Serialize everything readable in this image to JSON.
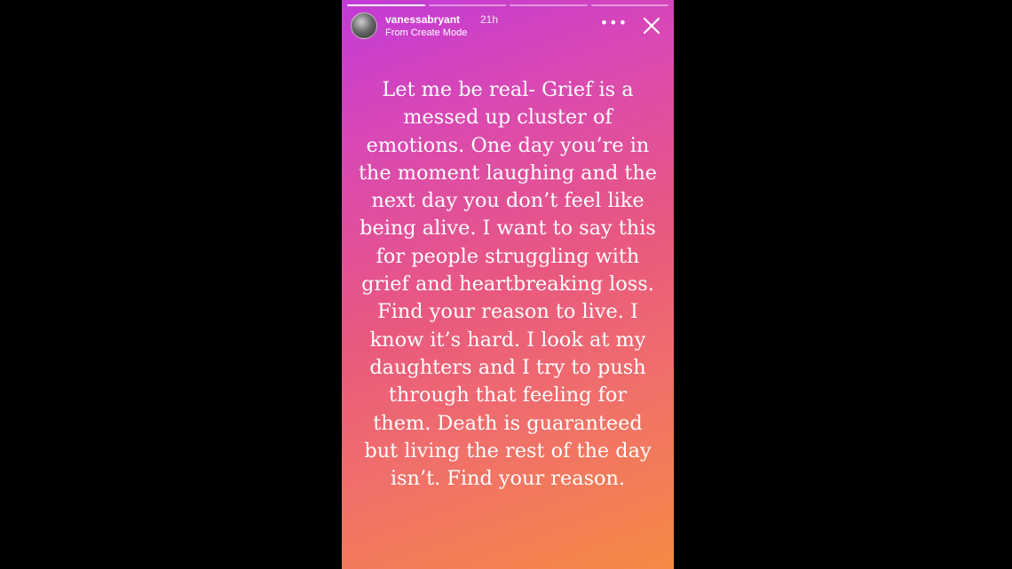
{
  "story": {
    "username": "vanessabryant",
    "time_ago": "21h",
    "subtitle": "From Create Mode",
    "more_icon": "more-horizontal-icon",
    "close_icon": "close-icon",
    "progress_segments": 4,
    "text": "Let me be real- Grief is a messed up cluster of emotions. One day you’re in the moment laughing and the next day you don’t feel like being alive. I want to say this for people struggling with grief and heartbreaking loss. Find your reason to live. I know it’s hard. I look at my daughters and I try to push through that feeling for them. Death is guaranteed but living the rest of the day isn’t. Find your reason."
  },
  "colors": {
    "gradient_top": "#c23ad8",
    "gradient_middle": "#e9587f",
    "gradient_bottom": "#f58a44",
    "letterbox": "#000000",
    "text": "#ffffff"
  }
}
